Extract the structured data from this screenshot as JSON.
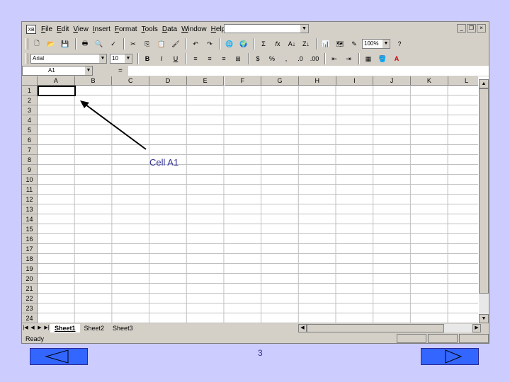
{
  "menu": {
    "app_icon_text": "XB",
    "items": [
      "File",
      "Edit",
      "View",
      "Insert",
      "Format",
      "Tools",
      "Data",
      "Window",
      "Help"
    ]
  },
  "toolbar": {
    "zoom": "100%",
    "font_name": "Arial",
    "font_size": "10",
    "bold_label": "B",
    "italic_label": "I",
    "underline_label": "U"
  },
  "formula_bar": {
    "name_box": "A1",
    "equals": "="
  },
  "grid": {
    "columns": [
      "A",
      "B",
      "C",
      "D",
      "E",
      "F",
      "G",
      "H",
      "I",
      "J",
      "K",
      "L"
    ],
    "rows": [
      "1",
      "2",
      "3",
      "4",
      "5",
      "6",
      "7",
      "8",
      "9",
      "10",
      "11",
      "12",
      "13",
      "14",
      "15",
      "16",
      "17",
      "18",
      "19",
      "20",
      "21",
      "22",
      "23",
      "24"
    ]
  },
  "sheets": {
    "tabs": [
      "Sheet1",
      "Sheet2",
      "Sheet3"
    ],
    "active_index": 0
  },
  "status": {
    "text": "Ready"
  },
  "slide": {
    "callout": "Cell A1",
    "page_number": "3",
    "background_color": "#ccccff",
    "nav_color": "#3366ff"
  }
}
